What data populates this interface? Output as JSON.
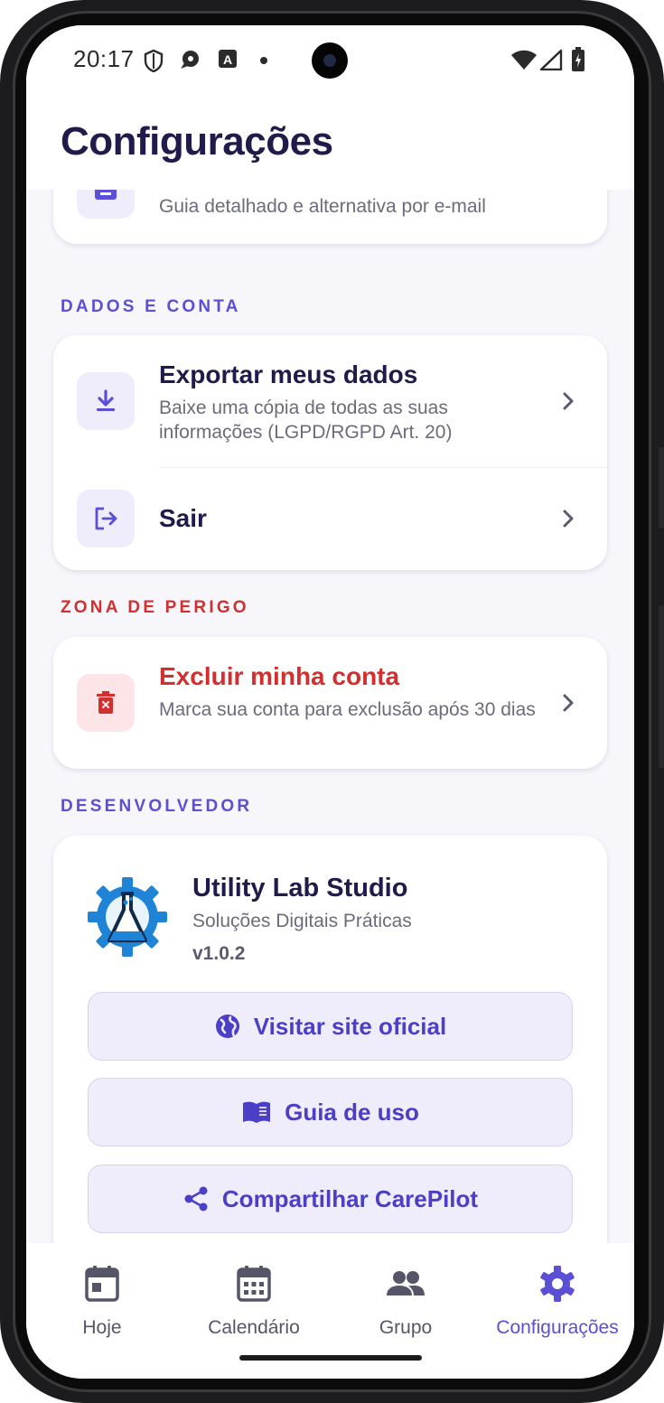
{
  "status_bar": {
    "time": "20:17"
  },
  "header": {
    "title": "Configurações"
  },
  "help_card": {
    "subtitle": "Guia detalhado e alternativa por e-mail"
  },
  "sections": {
    "data_account": {
      "label": "DADOS E CONTA",
      "export": {
        "title": "Exportar meus dados",
        "subtitle": "Baixe uma cópia de todas as suas informações (LGPD/RGPD Art. 20)"
      },
      "logout": {
        "title": "Sair"
      }
    },
    "danger_zone": {
      "label": "ZONA DE PERIGO",
      "delete": {
        "title": "Excluir minha conta",
        "subtitle": "Marca sua conta para exclusão após 30 dias"
      }
    },
    "developer": {
      "label": "DESENVOLVEDOR",
      "name": "Utility Lab Studio",
      "tagline": "Soluções Digitais Práticas",
      "version": "v1.0.2",
      "buttons": {
        "website": "Visitar site oficial",
        "guide": "Guia de uso",
        "share": "Compartilhar CarePilot"
      }
    }
  },
  "bottom_nav": {
    "items": [
      {
        "label": "Hoje",
        "icon": "calendar-day-icon"
      },
      {
        "label": "Calendário",
        "icon": "calendar-icon"
      },
      {
        "label": "Grupo",
        "icon": "group-icon"
      },
      {
        "label": "Configurações",
        "icon": "gear-icon",
        "active": true
      }
    ]
  },
  "colors": {
    "accent": "#5b4fd6",
    "danger": "#d32f2f",
    "title": "#1f1b4a",
    "background": "#f6f6fb"
  }
}
